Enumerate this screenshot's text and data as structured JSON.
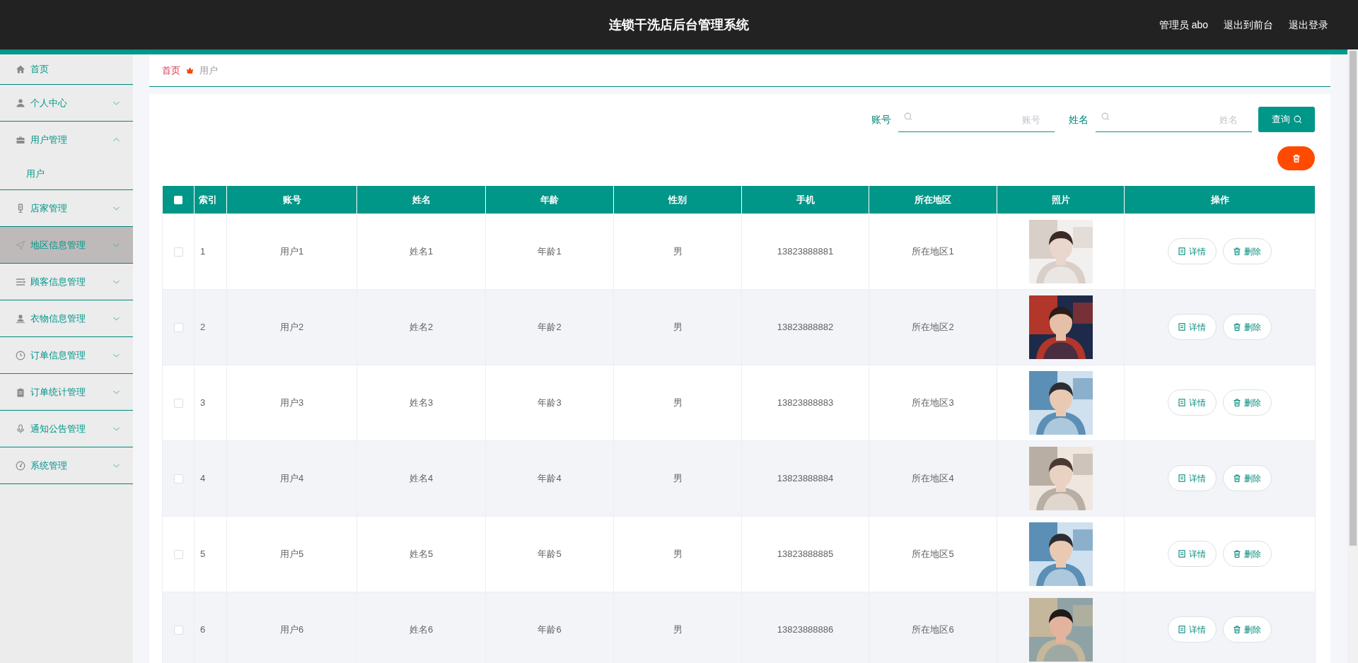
{
  "header": {
    "title": "连锁干洗店后台管理系统",
    "user": "管理员 abo",
    "links": [
      "退出到前台",
      "退出登录"
    ]
  },
  "sidebar": {
    "items": [
      {
        "label": "首页",
        "hovered": false
      },
      {
        "label": "个人中心",
        "expanded": false,
        "hovered": false
      },
      {
        "label": "用户管理",
        "expanded": true,
        "hovered": false,
        "children": [
          {
            "label": "用户"
          }
        ]
      },
      {
        "label": "店家管理",
        "expanded": false,
        "hovered": false
      },
      {
        "label": "地区信息管理",
        "expanded": false,
        "hovered": true
      },
      {
        "label": "顾客信息管理",
        "expanded": false,
        "hovered": false
      },
      {
        "label": "衣物信息管理",
        "expanded": false,
        "hovered": false
      },
      {
        "label": "订单信息管理",
        "expanded": false,
        "hovered": false
      },
      {
        "label": "订单统计管理",
        "expanded": false,
        "hovered": false
      },
      {
        "label": "通知公告管理",
        "expanded": false,
        "hovered": false
      },
      {
        "label": "系统管理",
        "expanded": false,
        "hovered": false
      }
    ]
  },
  "breadcrumb": [
    "首页",
    "用户"
  ],
  "search": {
    "fields": [
      {
        "label": "账号",
        "placeholder": "账号"
      },
      {
        "label": "姓名",
        "placeholder": "姓名"
      }
    ],
    "button": "查询"
  },
  "table": {
    "select_all": {
      "checked": false
    },
    "columns": [
      "索引",
      "账号",
      "姓名",
      "年龄",
      "性别",
      "手机",
      "所在地区",
      "照片",
      "操作"
    ],
    "rows": [
      {
        "checked": false,
        "cells": [
          "1",
          "用户1",
          "姓名1",
          "年龄1",
          "男",
          "13823888881",
          "所在地区1"
        ],
        "actions": [
          "详情",
          "删除"
        ]
      },
      {
        "checked": false,
        "cells": [
          "2",
          "用户2",
          "姓名2",
          "年龄2",
          "男",
          "13823888882",
          "所在地区2"
        ],
        "actions": [
          "详情",
          "删除"
        ]
      },
      {
        "checked": false,
        "cells": [
          "3",
          "用户3",
          "姓名3",
          "年龄3",
          "男",
          "13823888883",
          "所在地区3"
        ],
        "actions": [
          "详情",
          "删除"
        ]
      },
      {
        "checked": false,
        "cells": [
          "4",
          "用户4",
          "姓名4",
          "年龄4",
          "男",
          "13823888884",
          "所在地区4"
        ],
        "actions": [
          "详情",
          "删除"
        ]
      },
      {
        "checked": false,
        "cells": [
          "5",
          "用户5",
          "姓名5",
          "年龄5",
          "男",
          "13823888885",
          "所在地区5"
        ],
        "actions": [
          "详情",
          "删除"
        ]
      },
      {
        "checked": false,
        "cells": [
          "6",
          "用户6",
          "姓名6",
          "年龄6",
          "男",
          "13823888886",
          "所在地区6"
        ],
        "actions": [
          "详情",
          "删除"
        ]
      }
    ]
  }
}
